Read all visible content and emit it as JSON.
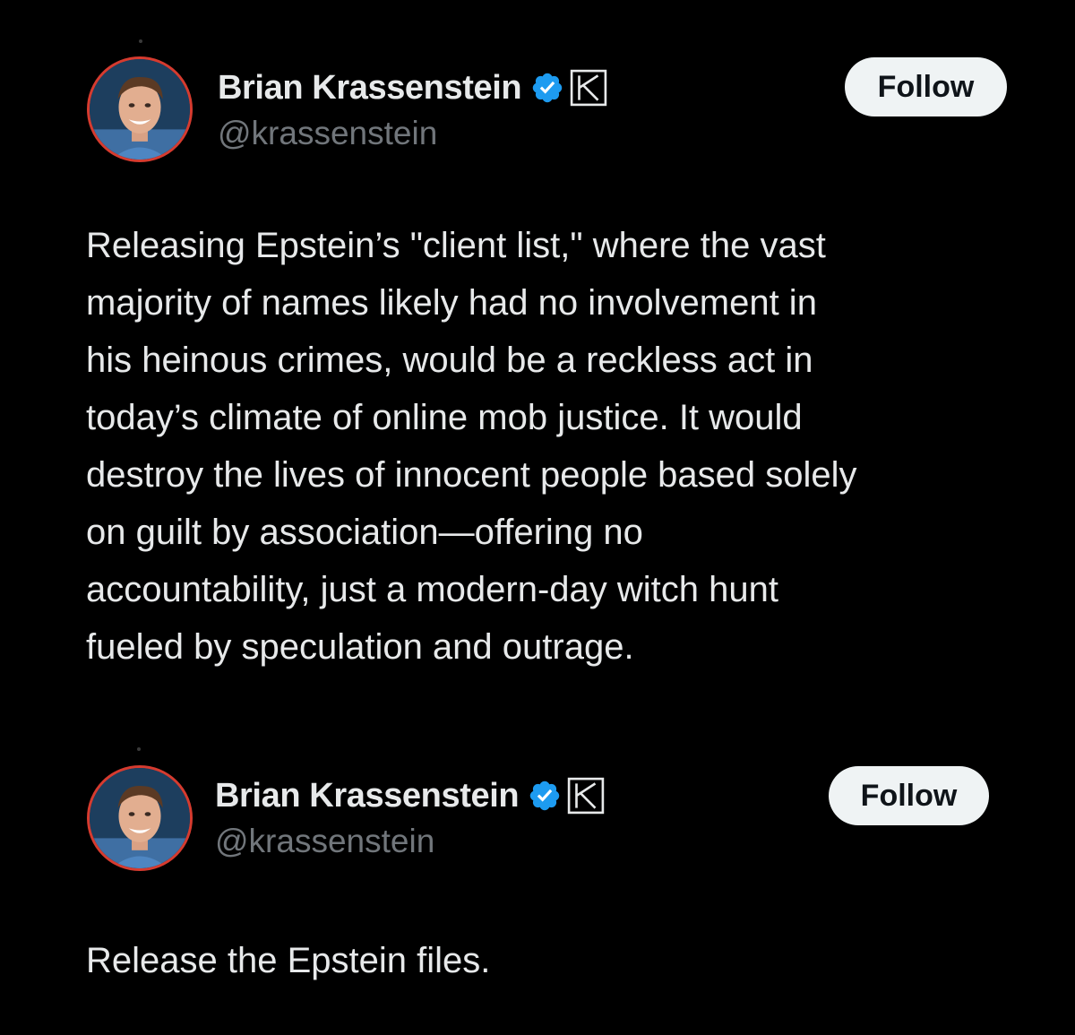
{
  "colors": {
    "background": "#000000",
    "text_primary": "#e7e9ea",
    "text_secondary": "#71767b",
    "verified_blue": "#1d9bf0",
    "follow_button_bg": "#eff3f4",
    "avatar_ring": "#d63b2f"
  },
  "tweets": [
    {
      "author": {
        "display_name": "Brian Krassenstein",
        "handle": "@krassenstein",
        "verified_icon": "verified-badge-icon",
        "affiliate_icon": "affiliate-k-icon"
      },
      "follow_label": "Follow",
      "text": "Releasing Epstein’s \"client list,\" where the vast\nmajority of names likely had no involvement in\nhis heinous crimes, would be a reckless act in\ntoday’s climate of online mob justice. It would\ndestroy the lives of innocent people based solely\non guilt by association—offering no\naccountability, just a modern-day witch hunt\nfueled by speculation and outrage."
    },
    {
      "author": {
        "display_name": "Brian Krassenstein",
        "handle": "@krassenstein",
        "verified_icon": "verified-badge-icon",
        "affiliate_icon": "affiliate-k-icon"
      },
      "follow_label": "Follow",
      "text": "Release the Epstein files."
    }
  ]
}
